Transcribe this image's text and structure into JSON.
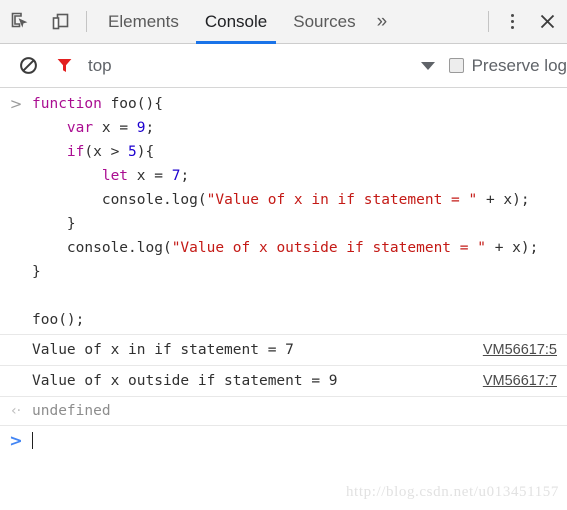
{
  "tabbar": {
    "inspect_icon": "inspect-element-icon",
    "device_icon": "device-toolbar-icon",
    "tabs": [
      {
        "label": "Elements",
        "active": false
      },
      {
        "label": "Console",
        "active": true
      },
      {
        "label": "Sources",
        "active": false
      }
    ],
    "more_tabs": "»",
    "kebab_icon": "more-options-icon",
    "close_icon": "close-icon"
  },
  "filterbar": {
    "clear_icon": "clear-console-icon",
    "filter_icon": "filter-funnel-icon",
    "context": "top",
    "caret_icon": "chevron-down-icon",
    "preserve_log_label": "Preserve log",
    "preserve_log_checked": false
  },
  "console": {
    "input_prompt": ">",
    "code_lines": [
      [
        {
          "t": "function",
          "c": "kw"
        },
        {
          "t": " foo(){",
          "c": ""
        }
      ],
      [
        {
          "t": "    ",
          "c": ""
        },
        {
          "t": "var",
          "c": "kw"
        },
        {
          "t": " x = ",
          "c": ""
        },
        {
          "t": "9",
          "c": "num"
        },
        {
          "t": ";",
          "c": ""
        }
      ],
      [
        {
          "t": "    ",
          "c": ""
        },
        {
          "t": "if",
          "c": "kw"
        },
        {
          "t": "(x > ",
          "c": ""
        },
        {
          "t": "5",
          "c": "num"
        },
        {
          "t": "){",
          "c": ""
        }
      ],
      [
        {
          "t": "        ",
          "c": ""
        },
        {
          "t": "let",
          "c": "kw"
        },
        {
          "t": " x = ",
          "c": ""
        },
        {
          "t": "7",
          "c": "num"
        },
        {
          "t": ";",
          "c": ""
        }
      ],
      [
        {
          "t": "        console.log(",
          "c": ""
        },
        {
          "t": "\"Value of x in if statement = \"",
          "c": "str"
        },
        {
          "t": " + x);",
          "c": ""
        }
      ],
      [
        {
          "t": "    }",
          "c": ""
        }
      ],
      [
        {
          "t": "    console.log(",
          "c": ""
        },
        {
          "t": "\"Value of x outside if statement = \"",
          "c": "str"
        },
        {
          "t": " + x);",
          "c": ""
        }
      ],
      [
        {
          "t": "}",
          "c": ""
        }
      ],
      [
        {
          "t": "",
          "c": ""
        }
      ],
      [
        {
          "t": "foo();",
          "c": ""
        }
      ]
    ],
    "log_messages": [
      {
        "text": "Value of x in if statement = 7",
        "source": "VM56617:5"
      },
      {
        "text": "Value of x outside if statement = 9",
        "source": "VM56617:7"
      }
    ],
    "result_arrow": "‹·",
    "result_value": "undefined",
    "prompt_arrow": ">",
    "prompt_value": ""
  },
  "watermark": "http://blog.csdn.net/u013451157",
  "colors": {
    "accent": "#1a73e8",
    "keyword": "#aa0d91",
    "number": "#1c00cf",
    "string": "#c41a16",
    "filter_icon": "#e32020",
    "prompt": "#4285f4"
  }
}
